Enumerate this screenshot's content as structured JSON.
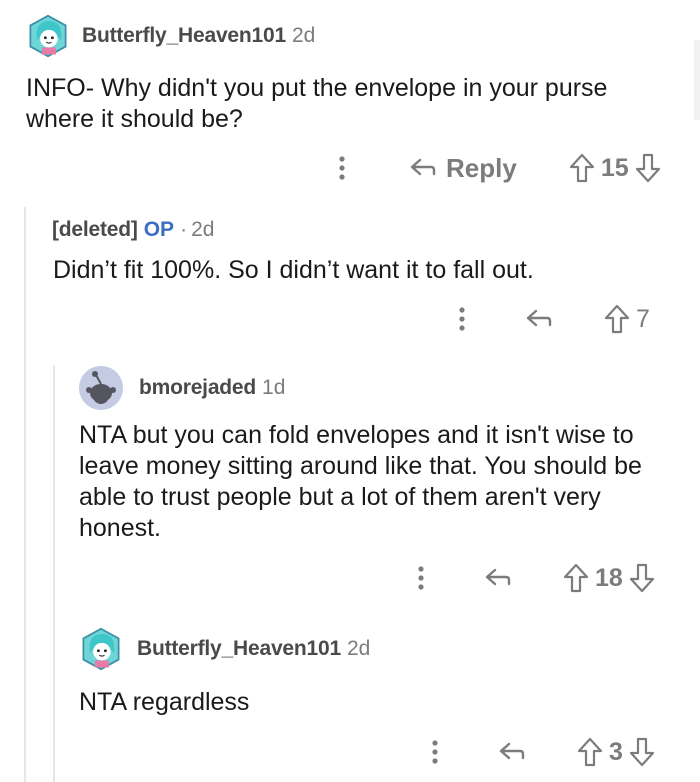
{
  "colors": {
    "muted": "#7c7c7c",
    "text": "#1a1a1b",
    "op_blue": "#3c6ec0",
    "thread_line": "#e6e6e6"
  },
  "comments": [
    {
      "username": "Butterfly_Heaven101",
      "time": "2d",
      "body": "INFO- Why didn't you put the envelope in your purse where it should be?",
      "reply_label": "Reply",
      "votes": "15",
      "avatar_icon": "snoo-avatar-teal-hair-icon"
    },
    {
      "username": "[deleted]",
      "op_badge": "OP",
      "dot": "·",
      "time": "2d",
      "body": "Didn’t fit 100%. So I didn’t want it to fall out.",
      "votes": "7"
    },
    {
      "username": "bmorejaded",
      "time": "1d",
      "body": "NTA but you can fold envelopes and it isn't wise to leave money sitting around like that.  You should be able to trust people but a lot of them aren't very honest.",
      "votes": "18",
      "avatar_icon": "default-snoo-avatar-icon"
    },
    {
      "username": "Butterfly_Heaven101",
      "time": "2d",
      "body": "NTA regardless",
      "votes": "3",
      "avatar_icon": "snoo-avatar-teal-hair-icon"
    }
  ]
}
